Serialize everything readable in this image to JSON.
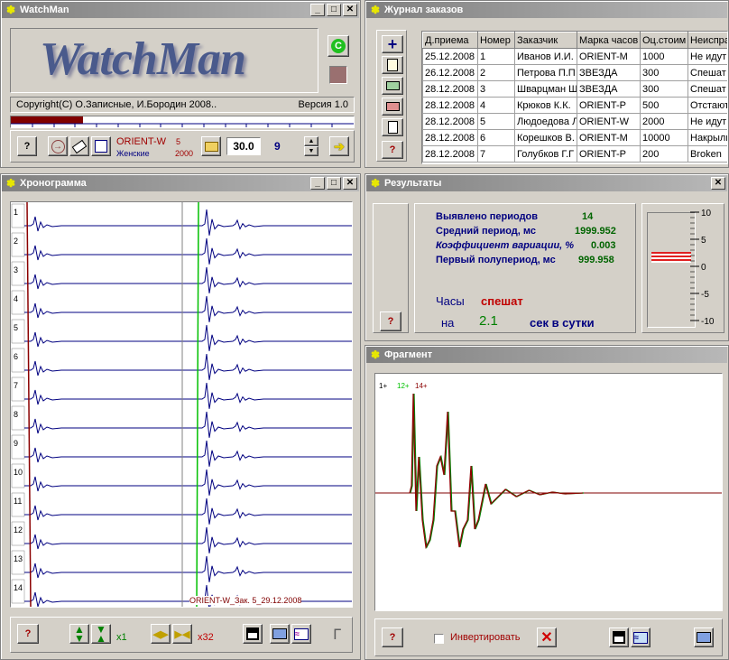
{
  "app": {
    "title": "WatchMan",
    "logo_text": "WatchMan",
    "copyright": "Copyright(C)  О.Записные, И.Бородин 2008..",
    "version": "Версия 1.0",
    "help_label": "?",
    "watch_model": "ORIENT-W",
    "watch_type": "Женские",
    "order_number": "5",
    "year": "2000",
    "value_field": "30.0",
    "count": "9",
    "progress_fraction": 0.21
  },
  "journal": {
    "title": "Журнал заказов",
    "columns": [
      "Д.приема",
      "Номер",
      "Заказчик",
      "Марка часов",
      "Оц.стоим",
      "Неиспра"
    ],
    "rows": [
      [
        "25.12.2008",
        "1",
        "Иванов И.И.",
        "ORIENT-M",
        "1000",
        "Не идут"
      ],
      [
        "26.12.2008",
        "2",
        "Петрова П.П",
        "ЗВЕЗДА",
        "300",
        "Спешат"
      ],
      [
        "28.12.2008",
        "3",
        "Шварцман Ш",
        "ЗВЕЗДА",
        "300",
        "Спешат"
      ],
      [
        "28.12.2008",
        "4",
        "Крюков К.К.",
        "ORIENT-P",
        "500",
        "Отстают"
      ],
      [
        "28.12.2008",
        "5",
        "Людоедова Л",
        "ORIENT-W",
        "2000",
        "Не идут"
      ],
      [
        "28.12.2008",
        "6",
        "Корешков В.",
        "ORIENT-M",
        "10000",
        "Накрылис"
      ],
      [
        "28.12.2008",
        "7",
        "Голубков Г.Г",
        "ORIENT-P",
        "200",
        "Broken"
      ]
    ],
    "help_label": "?"
  },
  "chrono": {
    "title": "Хронограмма",
    "row_labels": [
      "1",
      "2",
      "3",
      "4",
      "5",
      "6",
      "7",
      "8",
      "9",
      "10",
      "11",
      "12",
      "13",
      "14"
    ],
    "caption": "ORIENT-W_Зак. 5_29.12.2008",
    "zoom_x": "x1",
    "zoom_y": "x32",
    "help_label": "?"
  },
  "results": {
    "title": "Результаты",
    "periods_label": "Выявлено периодов",
    "periods_value": "14",
    "avg_label": "Средний период, мс",
    "avg_value": "1999.952",
    "coef_label": "Коэффициент вариации, %",
    "coef_value": "0.003",
    "first_label": "Первый полупериод, мс",
    "first_value": "999.958",
    "watch_label": "Часы",
    "status": "спешат",
    "on_label": "на",
    "delta": "2.1",
    "per_day": "сек в сутки",
    "help_label": "?",
    "gauge_ticks": [
      "10",
      "5",
      "0",
      "-5",
      "-10"
    ],
    "gauge_value": 2.1
  },
  "fragment": {
    "title": "Фрагмент",
    "markers": [
      "1+",
      "12+",
      "14+"
    ],
    "invert_label": "Инвертировать",
    "help_label": "?"
  },
  "colors": {
    "titlebar": "#808080",
    "trace": "#000080",
    "marker_red": "#8b0000",
    "marker_green": "#00c000",
    "status_red": "#c00000"
  }
}
